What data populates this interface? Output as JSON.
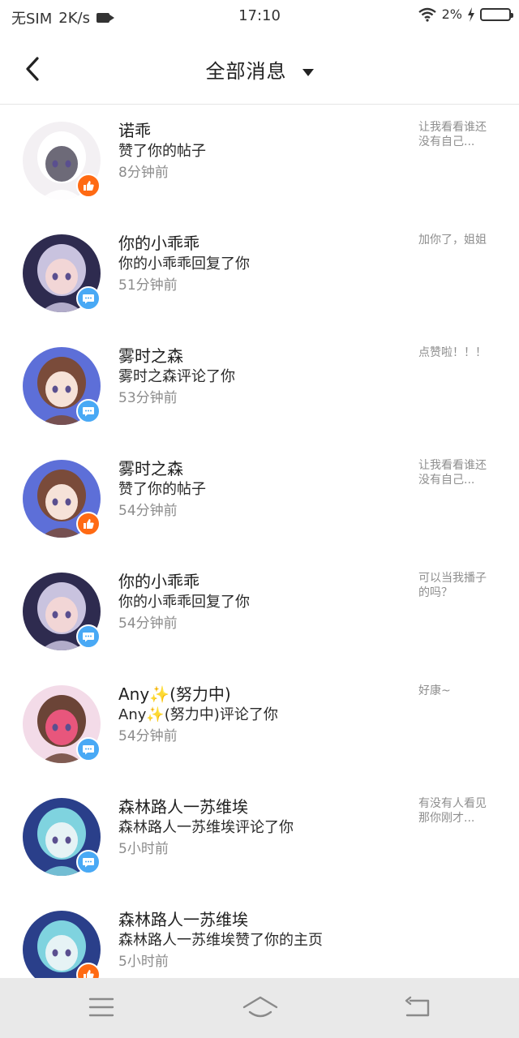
{
  "status_bar": {
    "carrier": "无SIM",
    "speed": "2K/s",
    "time": "17:10",
    "battery": "2%"
  },
  "header": {
    "title": "全部消息"
  },
  "messages": [
    {
      "name": "诺乖",
      "action": "赞了你的帖子",
      "time": "8分钟前",
      "preview": "让我看看谁还没有自己...",
      "badge": "like",
      "avatar": [
        "#f3f0f3",
        "#ffffff",
        "#6d6a78"
      ]
    },
    {
      "name": "你的小乖乖",
      "action": "你的小乖乖回复了你",
      "time": "51分钟前",
      "preview": "加你了，姐姐",
      "badge": "comment",
      "avatar": [
        "#2e2b4f",
        "#c9c3df",
        "#f2d6d6"
      ]
    },
    {
      "name": "雾时之森",
      "action": "雾时之森评论了你",
      "time": "53分钟前",
      "preview": "点赞啦！！！",
      "badge": "comment",
      "avatar": [
        "#5d6fd8",
        "#7a4b3a",
        "#f6e2d8"
      ]
    },
    {
      "name": "雾时之森",
      "action": "赞了你的帖子",
      "time": "54分钟前",
      "preview": "让我看看谁还没有自己...",
      "badge": "like",
      "avatar": [
        "#5d6fd8",
        "#7a4b3a",
        "#f6e2d8"
      ]
    },
    {
      "name": "你的小乖乖",
      "action": "你的小乖乖回复了你",
      "time": "54分钟前",
      "preview": "可以当我播子的吗？",
      "badge": "comment",
      "avatar": [
        "#2e2b4f",
        "#c9c3df",
        "#f2d6d6"
      ]
    },
    {
      "name": "Any✨(努力中)",
      "action": "Any✨(努力中)评论了你",
      "time": "54分钟前",
      "preview": "好康~",
      "badge": "comment",
      "avatar": [
        "#f3dbe8",
        "#6b4437",
        "#e8567c"
      ]
    },
    {
      "name": "森林路人一苏维埃",
      "action": "森林路人一苏维埃评论了你",
      "time": "5小时前",
      "preview": "有没有人看见那你刚才...",
      "badge": "comment",
      "avatar": [
        "#2a3f8a",
        "#7fd3df",
        "#e6f3f5"
      ]
    },
    {
      "name": "森林路人一苏维埃",
      "action": "森林路人一苏维埃赞了你的主页",
      "time": "5小时前",
      "preview": "",
      "badge": "like",
      "avatar": [
        "#2a3f8a",
        "#7fd3df",
        "#e6f3f5"
      ]
    }
  ],
  "colors": {
    "like_badge": "#ff6a13",
    "comment_badge": "#49a9f5",
    "time_text": "#8c8c8c",
    "nav_bar_bg": "#e9e9e9"
  },
  "icons": {
    "back": "chevron-left-icon",
    "dropdown": "caret-down-icon",
    "like_badge": "thumbs-up-icon",
    "comment_badge": "chat-bubble-icon",
    "nav_menu": "menu-icon",
    "nav_home": "home-icon",
    "nav_back": "return-icon"
  }
}
